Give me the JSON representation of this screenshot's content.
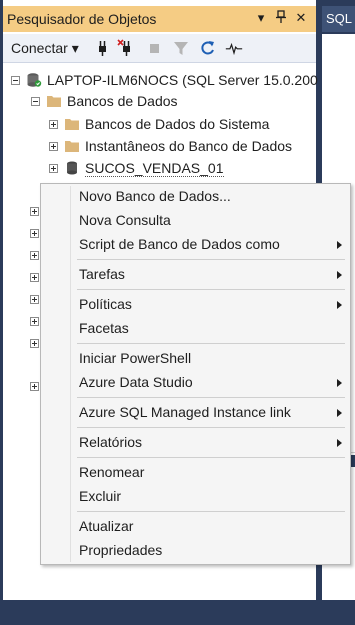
{
  "panel": {
    "title": "Pesquisador de Objetos",
    "pin_glyph": "▾",
    "pin2_glyph": "⊥",
    "close_glyph": "✕"
  },
  "toolbar": {
    "connect_label": "Conectar",
    "connect_arrow": "▾",
    "icons": [
      "connect-plug-icon",
      "disconnect-icon",
      "stop-icon",
      "filter-icon",
      "refresh-icon",
      "activity-monitor-icon"
    ]
  },
  "right_tab": {
    "label": "SQL"
  },
  "tree": {
    "server": "LAPTOP-ILM6NOCS (SQL Server 15.0.200",
    "databases_folder": "Bancos de Dados",
    "system_databases": "Bancos de Dados do Sistema",
    "snapshots": "Instantâneos do Banco de Dados",
    "database": "SUCOS_VENDAS_01"
  },
  "context_menu": {
    "items": [
      {
        "label": "Novo Banco de Dados...",
        "submenu": false
      },
      {
        "label": "Nova Consulta",
        "submenu": false
      },
      {
        "label": "Script de Banco de Dados como",
        "submenu": true
      },
      {
        "label": "Tarefas",
        "submenu": true
      },
      {
        "label": "Políticas",
        "submenu": true
      },
      {
        "label": "Facetas",
        "submenu": false
      },
      {
        "label": "Iniciar PowerShell",
        "submenu": false
      },
      {
        "label": "Azure Data Studio",
        "submenu": true
      },
      {
        "label": "Azure SQL Managed Instance link",
        "submenu": true
      },
      {
        "label": "Relatórios",
        "submenu": true
      },
      {
        "label": "Renomear",
        "submenu": false
      },
      {
        "label": "Excluir",
        "submenu": false
      },
      {
        "label": "Atualizar",
        "submenu": false
      },
      {
        "label": "Propriedades",
        "submenu": false
      }
    ]
  },
  "colors": {
    "title_bar": "#f5cc84",
    "frame": "#2b3b5a",
    "menu_bg": "#f5f5f5",
    "folder": "#dcb67a"
  }
}
